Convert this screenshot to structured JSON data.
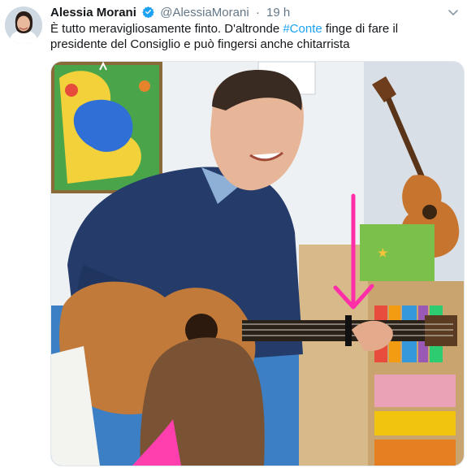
{
  "tweet": {
    "author_name": "Alessia Morani",
    "author_handle": "@AlessiaMorani",
    "separator": "·",
    "time": "19 h",
    "text_part1": "È tutto meravigliosamente finto. D'altronde ",
    "hashtag": "#Conte",
    "text_part2": " finge di fare il presidente del Consiglio e può fingersi anche chitarrista",
    "verified": true,
    "icons": {
      "verified": "verified-badge-icon",
      "menu": "chevron-down-icon"
    }
  },
  "media": {
    "annotation_arrow_color": "#ff2da8"
  },
  "colors": {
    "accent": "#1da1f2",
    "secondary_text": "#657786"
  }
}
